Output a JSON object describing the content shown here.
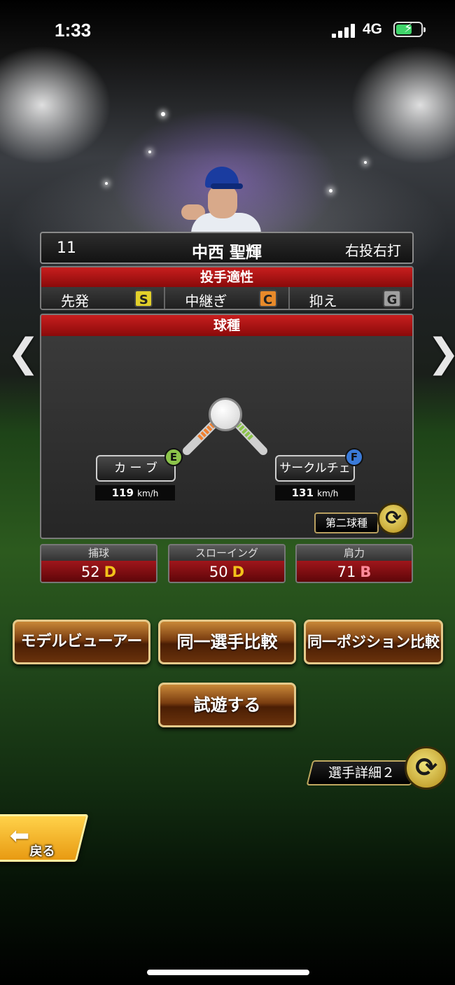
{
  "status_bar": {
    "time": "1:33",
    "network": "4G"
  },
  "player": {
    "number": "11",
    "name": "中西 聖輝",
    "handedness": "右投右打"
  },
  "aptitude": {
    "title": "投手適性",
    "items": [
      {
        "label": "先発",
        "grade": "S",
        "color": "#e2d02a"
      },
      {
        "label": "中継ぎ",
        "grade": "C",
        "color": "#e88a2a"
      },
      {
        "label": "抑え",
        "grade": "G",
        "color": "#a0a0a0"
      }
    ]
  },
  "pitches": {
    "title": "球種",
    "items": [
      {
        "name": "カ ー ブ",
        "grade": "E",
        "grade_color": "#8bc34a",
        "speed": "119",
        "unit": "km/h"
      },
      {
        "name": "サークルチェンジ",
        "grade": "F",
        "grade_color": "#3a7ad8",
        "speed": "131",
        "unit": "km/h"
      }
    ],
    "second_pitch_label": "第二球種"
  },
  "stats": [
    {
      "label": "捕球",
      "value": "52",
      "grade": "D",
      "grade_color": "#f2c21a"
    },
    {
      "label": "スローイング",
      "value": "50",
      "grade": "D",
      "grade_color": "#f2c21a"
    },
    {
      "label": "肩力",
      "value": "71",
      "grade": "B",
      "grade_color": "#ff8a9a"
    }
  ],
  "actions": {
    "model_viewer": "モデルビューアー",
    "same_player_compare": "同一選手比較",
    "same_position_compare": "同一ポジション比較",
    "try_play": "試遊する"
  },
  "player_detail_label": "選手詳細２",
  "back_label": "戻る",
  "icons": {
    "prev": "chevron-left-icon",
    "next": "chevron-right-icon",
    "swap": "swap-icon",
    "back": "back-arrow-icon"
  }
}
